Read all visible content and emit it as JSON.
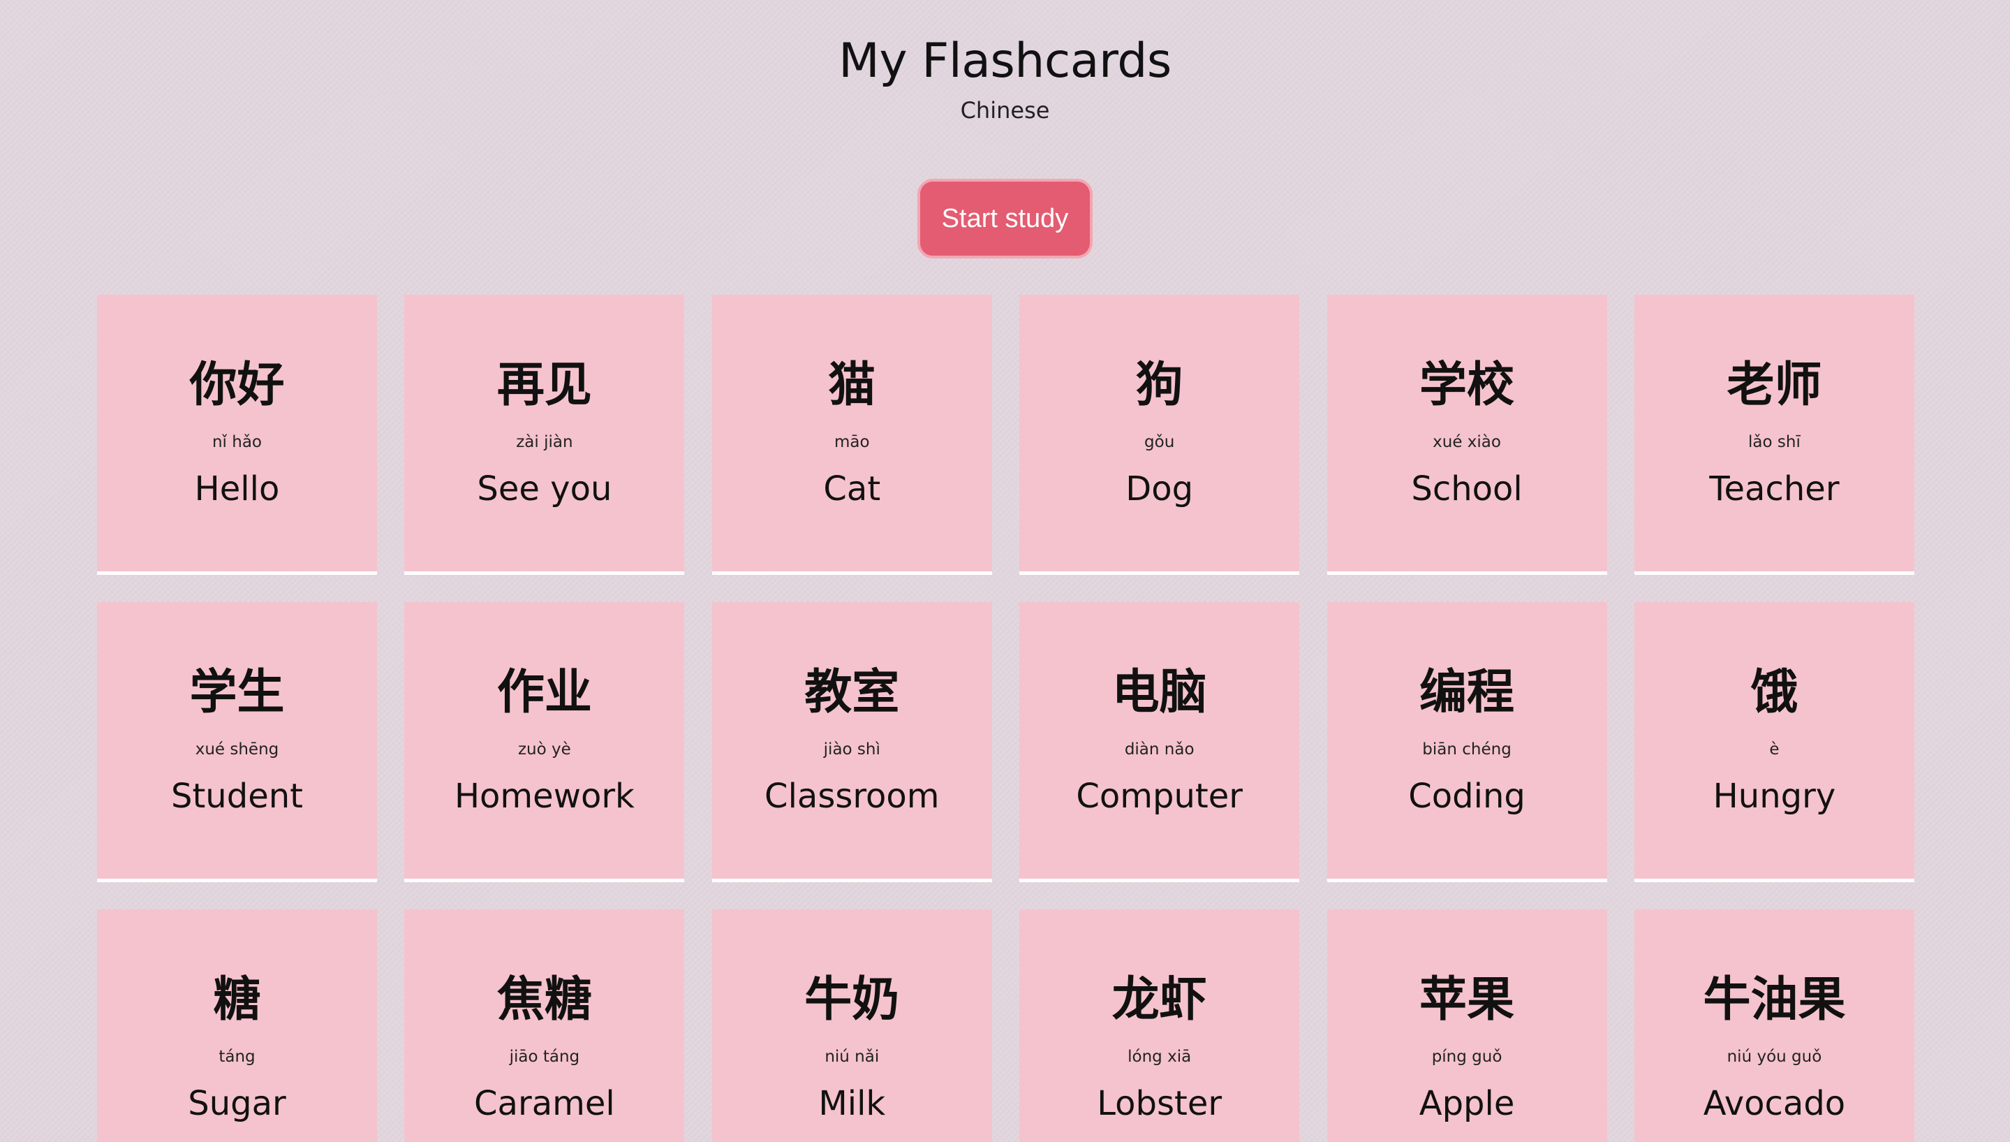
{
  "header": {
    "title": "My Flashcards",
    "subtitle": "Chinese"
  },
  "actions": {
    "start_study_label": "Start study"
  },
  "cards": [
    {
      "hanzi": "你好",
      "pinyin": "nǐ hǎo",
      "english": "Hello"
    },
    {
      "hanzi": "再见",
      "pinyin": "zài jiàn",
      "english": "See you"
    },
    {
      "hanzi": "猫",
      "pinyin": "māo",
      "english": "Cat"
    },
    {
      "hanzi": "狗",
      "pinyin": "gǒu",
      "english": "Dog"
    },
    {
      "hanzi": "学校",
      "pinyin": "xué xiào",
      "english": "School"
    },
    {
      "hanzi": "老师",
      "pinyin": "lǎo shī",
      "english": "Teacher"
    },
    {
      "hanzi": "学生",
      "pinyin": "xué shēng",
      "english": "Student"
    },
    {
      "hanzi": "作业",
      "pinyin": "zuò yè",
      "english": "Homework"
    },
    {
      "hanzi": "教室",
      "pinyin": "jiào shì",
      "english": "Classroom"
    },
    {
      "hanzi": "电脑",
      "pinyin": "diàn nǎo",
      "english": "Computer"
    },
    {
      "hanzi": "编程",
      "pinyin": "biān chéng",
      "english": "Coding"
    },
    {
      "hanzi": "饿",
      "pinyin": "è",
      "english": "Hungry"
    },
    {
      "hanzi": "糖",
      "pinyin": "táng",
      "english": "Sugar"
    },
    {
      "hanzi": "焦糖",
      "pinyin": "jiāo táng",
      "english": "Caramel"
    },
    {
      "hanzi": "牛奶",
      "pinyin": "niú nǎi",
      "english": "Milk"
    },
    {
      "hanzi": "龙虾",
      "pinyin": "lóng xiā",
      "english": "Lobster"
    },
    {
      "hanzi": "苹果",
      "pinyin": "píng guǒ",
      "english": "Apple"
    },
    {
      "hanzi": "牛油果",
      "pinyin": "niú yóu guǒ",
      "english": "Avocado"
    }
  ],
  "colors": {
    "background": "#e2d6de",
    "card": "#f5c3cd",
    "button": "#e35c71",
    "button_border": "#f3a6b2"
  }
}
